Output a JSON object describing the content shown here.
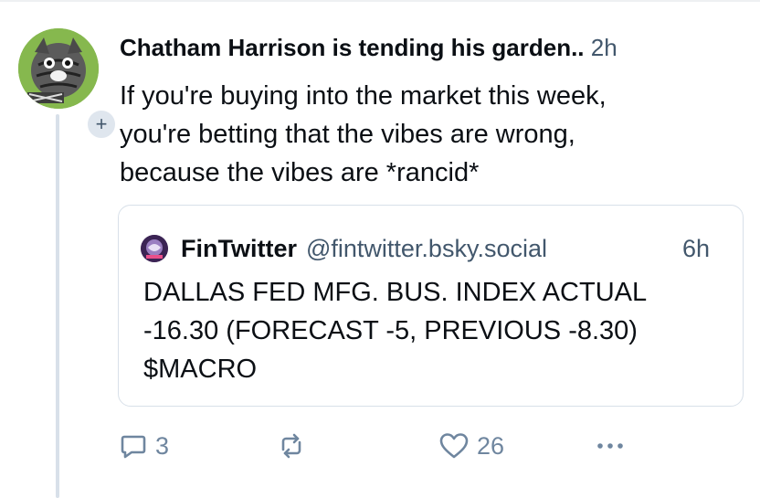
{
  "post": {
    "author": "Chatham Harrison is tending his garden..",
    "time": "2h",
    "text_line1": "If you're buying into the market this week,",
    "text_line2": "you're betting that the vibes are wrong,",
    "text_line3": "because the vibes are *rancid*",
    "follow_label": "+",
    "avatar_icon": "cat-illustration-avatar"
  },
  "quote": {
    "author": "FinTwitter",
    "handle": "@fintwitter.bsky.social",
    "time": "6h",
    "text_line1": "DALLAS FED MFG. BUS. INDEX ACTUAL",
    "text_line2": "-16.30 (FORECAST -5, PREVIOUS -8.30)",
    "text_line3": "$MACRO",
    "avatar_icon": "fintwitter-logo"
  },
  "actions": {
    "reply_count": "3",
    "repost_count": "",
    "like_count": "26",
    "icons": [
      "reply-icon",
      "repost-icon",
      "like-icon",
      "more-icon"
    ]
  },
  "colors": {
    "text": "#0b0f14",
    "muted": "#42576c",
    "action": "#6f869f",
    "border": "#d8e0e9"
  }
}
